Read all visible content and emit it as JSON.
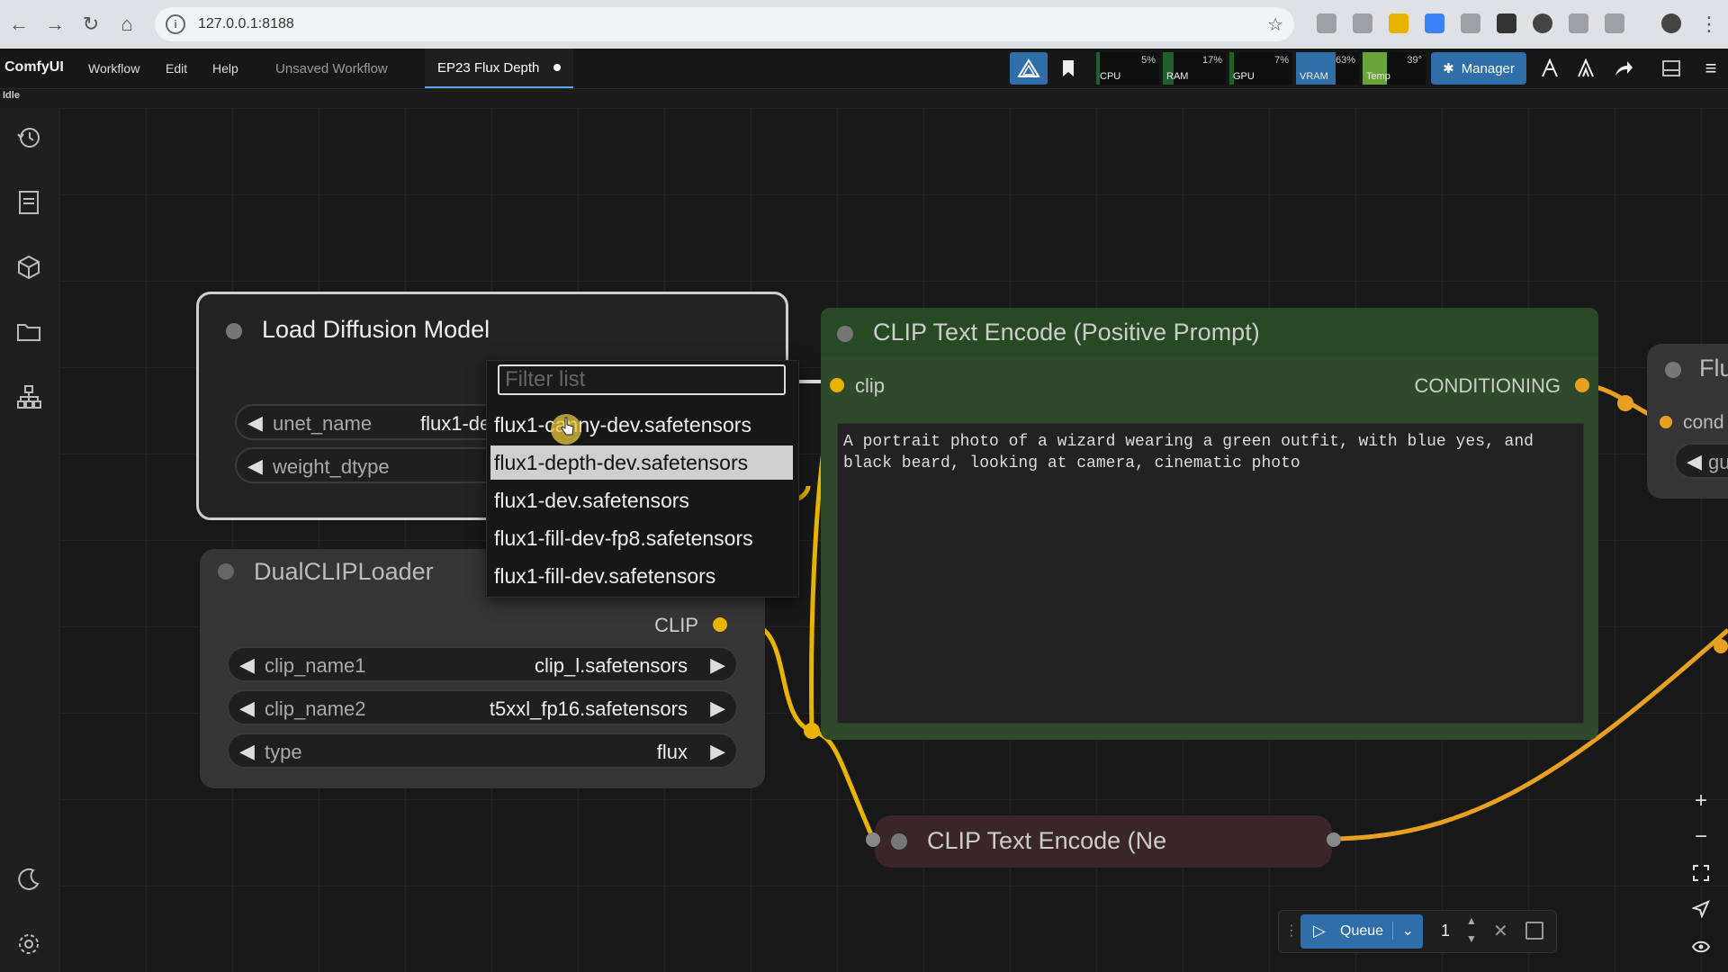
{
  "browser": {
    "url": "127.0.0.1:8188"
  },
  "app": {
    "brand": "ComfyUI",
    "menu": [
      "Workflow",
      "Edit",
      "Help"
    ],
    "tabs": [
      {
        "label": "Unsaved Workflow",
        "active": false
      },
      {
        "label": "EP23 Flux Depth",
        "active": true,
        "unsaved_dot": true
      }
    ],
    "status": "Idle",
    "accent_color": "#2f6ea8"
  },
  "monitors": [
    {
      "label": "CPU",
      "percent": "5%",
      "value": 5,
      "color": "#1f5f2a"
    },
    {
      "label": "RAM",
      "percent": "17%",
      "value": 17,
      "color": "#1f5f2a"
    },
    {
      "label": "GPU",
      "percent": "7%",
      "value": 7,
      "color": "#1f5f2a"
    },
    {
      "label": "VRAM",
      "percent": "63%",
      "value": 63,
      "color": "#2f6ea8"
    },
    {
      "label": "Temp",
      "percent": "39°",
      "value": 39,
      "color": "#6aa33a"
    }
  ],
  "manager_label": "Manager",
  "nodes": {
    "load_diffusion": {
      "title": "Load Diffusion Model",
      "widgets": [
        {
          "name": "unet_name",
          "value": "flux1-de"
        },
        {
          "name": "weight_dtype",
          "value": ""
        }
      ]
    },
    "dual_clip": {
      "title": "DualCLIPLoader",
      "output": "CLIP",
      "widgets": [
        {
          "name": "clip_name1",
          "value": "clip_l.safetensors"
        },
        {
          "name": "clip_name2",
          "value": "t5xxl_fp16.safetensors"
        },
        {
          "name": "type",
          "value": "flux"
        }
      ]
    },
    "clip_positive": {
      "title": "CLIP Text Encode (Positive Prompt)",
      "input": "clip",
      "output": "CONDITIONING",
      "text": "A portrait photo of a wizard wearing a green outfit, with blue yes, and black beard, looking at camera, cinematic photo"
    },
    "clip_negative": {
      "title": "CLIP Text Encode (Ne"
    },
    "flux_partial": {
      "title": "Flu",
      "input": "cond",
      "widget": "gu"
    }
  },
  "dropdown": {
    "placeholder": "Filter list",
    "items": [
      "flux1-canny-dev.safetensors",
      "flux1-depth-dev.safetensors",
      "flux1-dev.safetensors",
      "flux1-fill-dev-fp8.safetensors",
      "flux1-fill-dev.safetensors"
    ],
    "highlighted_index": 1
  },
  "queue": {
    "label": "Queue",
    "count": "1"
  }
}
